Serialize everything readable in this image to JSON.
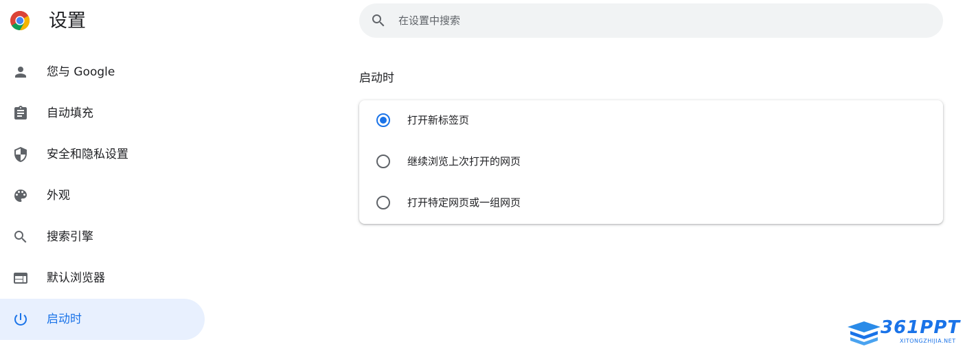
{
  "app": {
    "title": "设置"
  },
  "search": {
    "placeholder": "在设置中搜索",
    "icon": "search-icon"
  },
  "sidebar": {
    "items": [
      {
        "label": "您与 Google",
        "icon": "person-icon",
        "active": false
      },
      {
        "label": "自动填充",
        "icon": "clipboard-icon",
        "active": false
      },
      {
        "label": "安全和隐私设置",
        "icon": "shield-icon",
        "active": false
      },
      {
        "label": "外观",
        "icon": "palette-icon",
        "active": false
      },
      {
        "label": "搜索引擎",
        "icon": "search-icon",
        "active": false
      },
      {
        "label": "默认浏览器",
        "icon": "browser-icon",
        "active": false
      },
      {
        "label": "启动时",
        "icon": "power-icon",
        "active": true
      }
    ]
  },
  "main": {
    "section_title": "启动时",
    "options": [
      {
        "label": "打开新标签页",
        "checked": true
      },
      {
        "label": "继续浏览上次打开的网页",
        "checked": false
      },
      {
        "label": "打开特定网页或一组网页",
        "checked": false
      }
    ]
  },
  "watermark": {
    "text": "361PPT",
    "sub": "XITONGZHIJIA.NET"
  },
  "colors": {
    "accent": "#1a73e8",
    "active_bg": "#e8f0fe",
    "search_bg": "#f1f3f4",
    "icon_gray": "#5f6368"
  }
}
